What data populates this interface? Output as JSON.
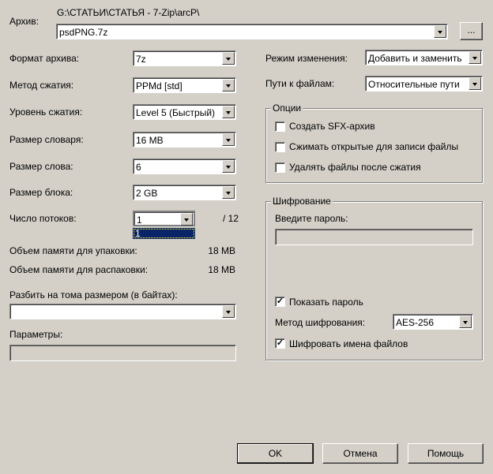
{
  "archive": {
    "label": "Архив:",
    "path": "G:\\СТАТЬИ\\СТАТЬЯ - 7-Zip\\arcP\\",
    "name": "psdPNG.7z",
    "browse": "..."
  },
  "left": {
    "format": {
      "label": "Формат архива:",
      "value": "7z"
    },
    "method": {
      "label": "Метод сжатия:",
      "value": "PPMd [std]"
    },
    "level": {
      "label": "Уровень сжатия:",
      "value": "Level 5 (Быстрый)"
    },
    "dict": {
      "label": "Размер словаря:",
      "value": "16 MB"
    },
    "word": {
      "label": "Размер слова:",
      "value": "6"
    },
    "block": {
      "label": "Размер блока:",
      "value": "2 GB"
    },
    "threads": {
      "label": "Число потоков:",
      "value": "1",
      "max": "/ 12",
      "options": [
        "1"
      ]
    },
    "mem_pack": {
      "label": "Объем памяти для упаковки:",
      "value": "18 MB"
    },
    "mem_unpack": {
      "label": "Объем памяти для распаковки:",
      "value": "18 MB"
    },
    "split": {
      "label": "Разбить на тома размером (в байтах):",
      "value": ""
    },
    "params": {
      "label": "Параметры:",
      "value": ""
    }
  },
  "right": {
    "update": {
      "label": "Режим изменения:",
      "value": "Добавить и заменить"
    },
    "paths": {
      "label": "Пути к файлам:",
      "value": "Относительные пути"
    },
    "options": {
      "title": "Опции",
      "items": [
        {
          "label": "Создать SFX-архив",
          "checked": false
        },
        {
          "label": "Сжимать открытые для записи файлы",
          "checked": false
        },
        {
          "label": "Удалять файлы после сжатия",
          "checked": false
        }
      ]
    },
    "encryption": {
      "title": "Шифрование",
      "password_label": "Введите пароль:",
      "password": "",
      "show_password": {
        "label": "Показать пароль",
        "checked": true
      },
      "method": {
        "label": "Метод шифрования:",
        "value": "AES-256"
      },
      "encrypt_names": {
        "label": "Шифровать имена файлов",
        "checked": true
      }
    }
  },
  "buttons": {
    "ok": "OK",
    "cancel": "Отмена",
    "help": "Помощь"
  }
}
